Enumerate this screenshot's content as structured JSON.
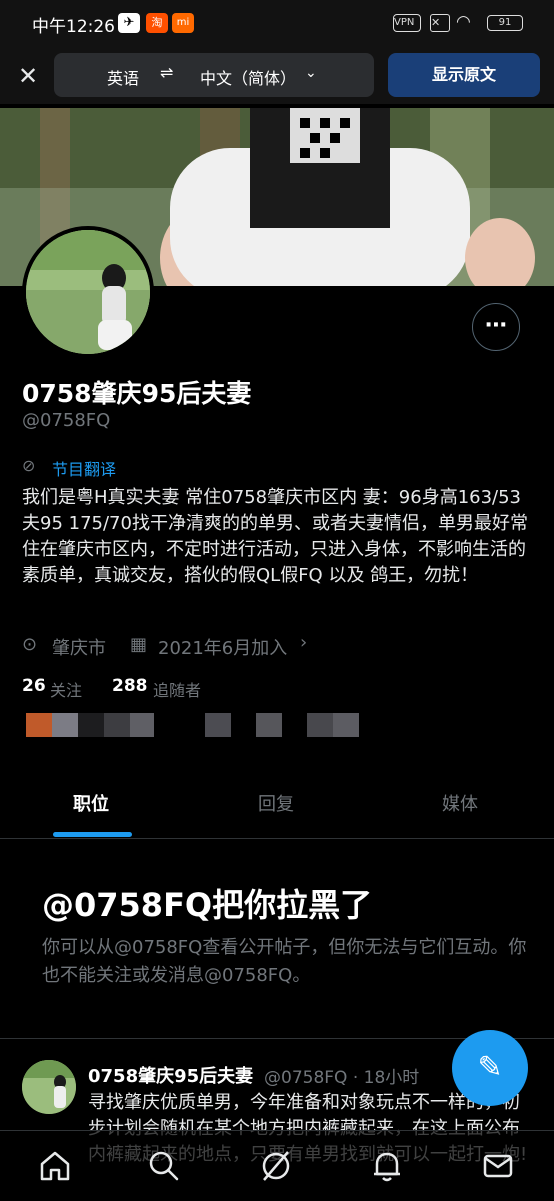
{
  "status_bar": {
    "time": "中午12:26",
    "vpn": "VPN",
    "battery": "91"
  },
  "translate_bar": {
    "source_lang": "英语",
    "swap": "⇌",
    "target_lang": "中文（简体）",
    "show_original": "显示原文"
  },
  "profile": {
    "display_name": "0758肇庆95后夫妻",
    "handle": "@0758FQ",
    "translate_link": "节目翻译",
    "bio": "我们是粤H真实夫妻 常住0758肇庆市区内 妻：96身高163/53 夫95 175/70找干净清爽的的单男、或者夫妻情侣，单男最好常住在肇庆市区内，不定时进行活动，只进入身体，不影响生活的素质单，真诚交友，搭伙的假QL假FQ 以及 鸽王，勿扰！",
    "location": "肇庆市",
    "joined": "2021年6月加入",
    "following_count": "26",
    "following_label": "关注",
    "followers_count": "288",
    "followers_label": "追随者"
  },
  "tabs": [
    "职位",
    "回复",
    "媒体"
  ],
  "blocked": {
    "title": "@0758FQ把你拉黑了",
    "description": "你可以从@0758FQ查看公开帖子，但你无法与它们互动。你也不能关注或发消息@0758FQ。"
  },
  "tweet": {
    "name": "0758肇庆95后夫妻",
    "handle_time": "@0758FQ · 18小时",
    "text": "寻找肇庆优质单男，今年准备和对象玩点不一样的，初步计划会随机在某个地方把内裤藏起来，在这上面公布内裤藏起来的地点，只要有单男找到就可以一起打一炮!"
  },
  "icons": {
    "close": "close-icon",
    "more": "more-options-icon",
    "location": "location-icon",
    "calendar": "calendar-icon",
    "translate": "translate-icon",
    "fab": "compose-icon",
    "nav": [
      "home-icon",
      "search-icon",
      "grok-icon",
      "notifications-icon",
      "messages-icon"
    ]
  },
  "colors": {
    "accent": "#1d9bf0",
    "background": "#000000",
    "muted": "#71767b"
  }
}
